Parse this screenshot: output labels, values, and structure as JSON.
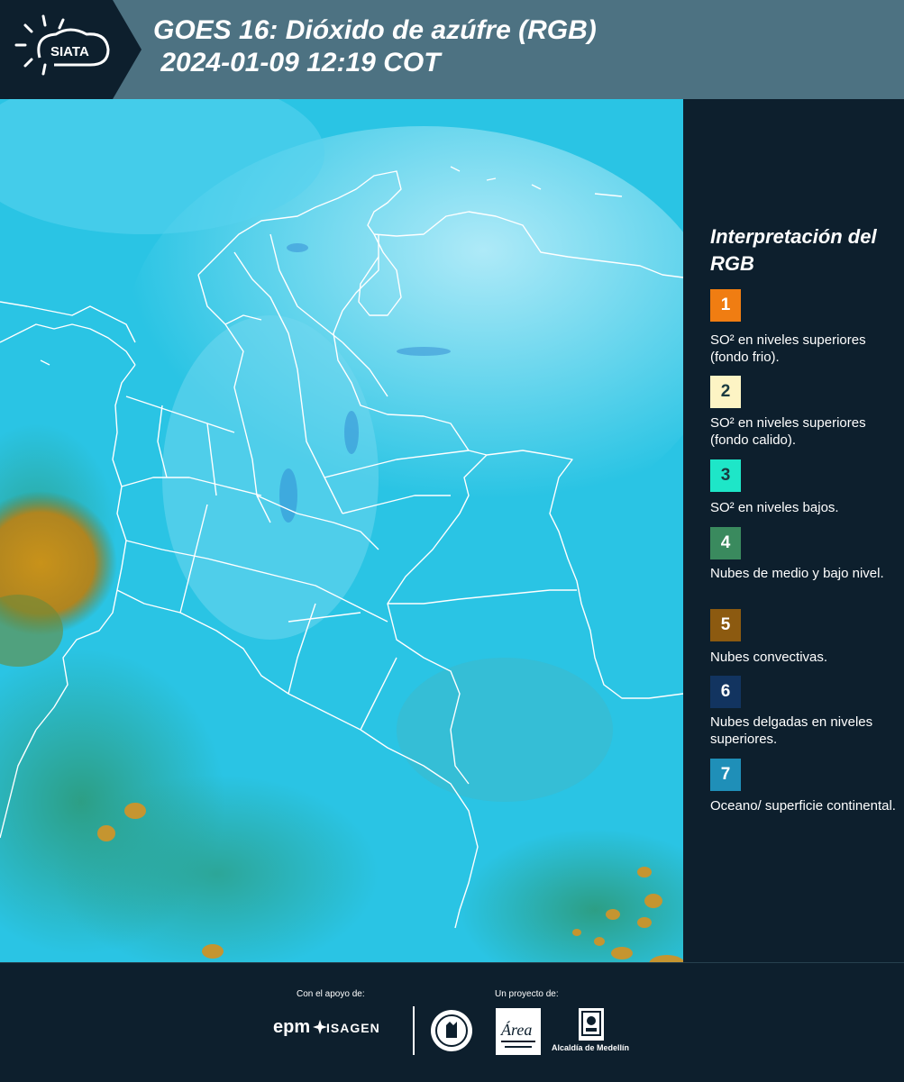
{
  "header": {
    "logo_text": "SIATA",
    "title_line1": "GOES 16: Dióxido de azúfre (RGB)",
    "title_line2": " 2024-01-09 12:19 COT",
    "background_color": "#4d7282"
  },
  "legend": {
    "title": "Interpretación del RGB",
    "items": [
      {
        "number": "1",
        "label": "SO² en niveles superiores (fondo frio).",
        "color": "#f07d12"
      },
      {
        "number": "2",
        "label": "SO² en niveles superiores (fondo calido).",
        "color": "#fdf4c4"
      },
      {
        "number": "3",
        "label": "SO² en niveles bajos.",
        "color": "#1ee6c8"
      },
      {
        "number": "4",
        "label": "Nubes de medio y bajo nivel.",
        "color": "#3a8a5e"
      },
      {
        "number": "5",
        "label": "Nubes convectivas.",
        "color": "#8c5a10"
      },
      {
        "number": "6",
        "label": "Nubes delgadas en niveles superiores.",
        "color": "#123460"
      },
      {
        "number": "7",
        "label": "Oceano/ superficie continental.",
        "color": "#1f8fb8"
      }
    ]
  },
  "footer": {
    "support_label": "Con el apoyo de:",
    "project_label": "Un proyecto de:",
    "epm": "epm",
    "isagen": "ISAGEN",
    "area_text": "Área",
    "alcaldia": "Alcaldía de Medellín"
  }
}
